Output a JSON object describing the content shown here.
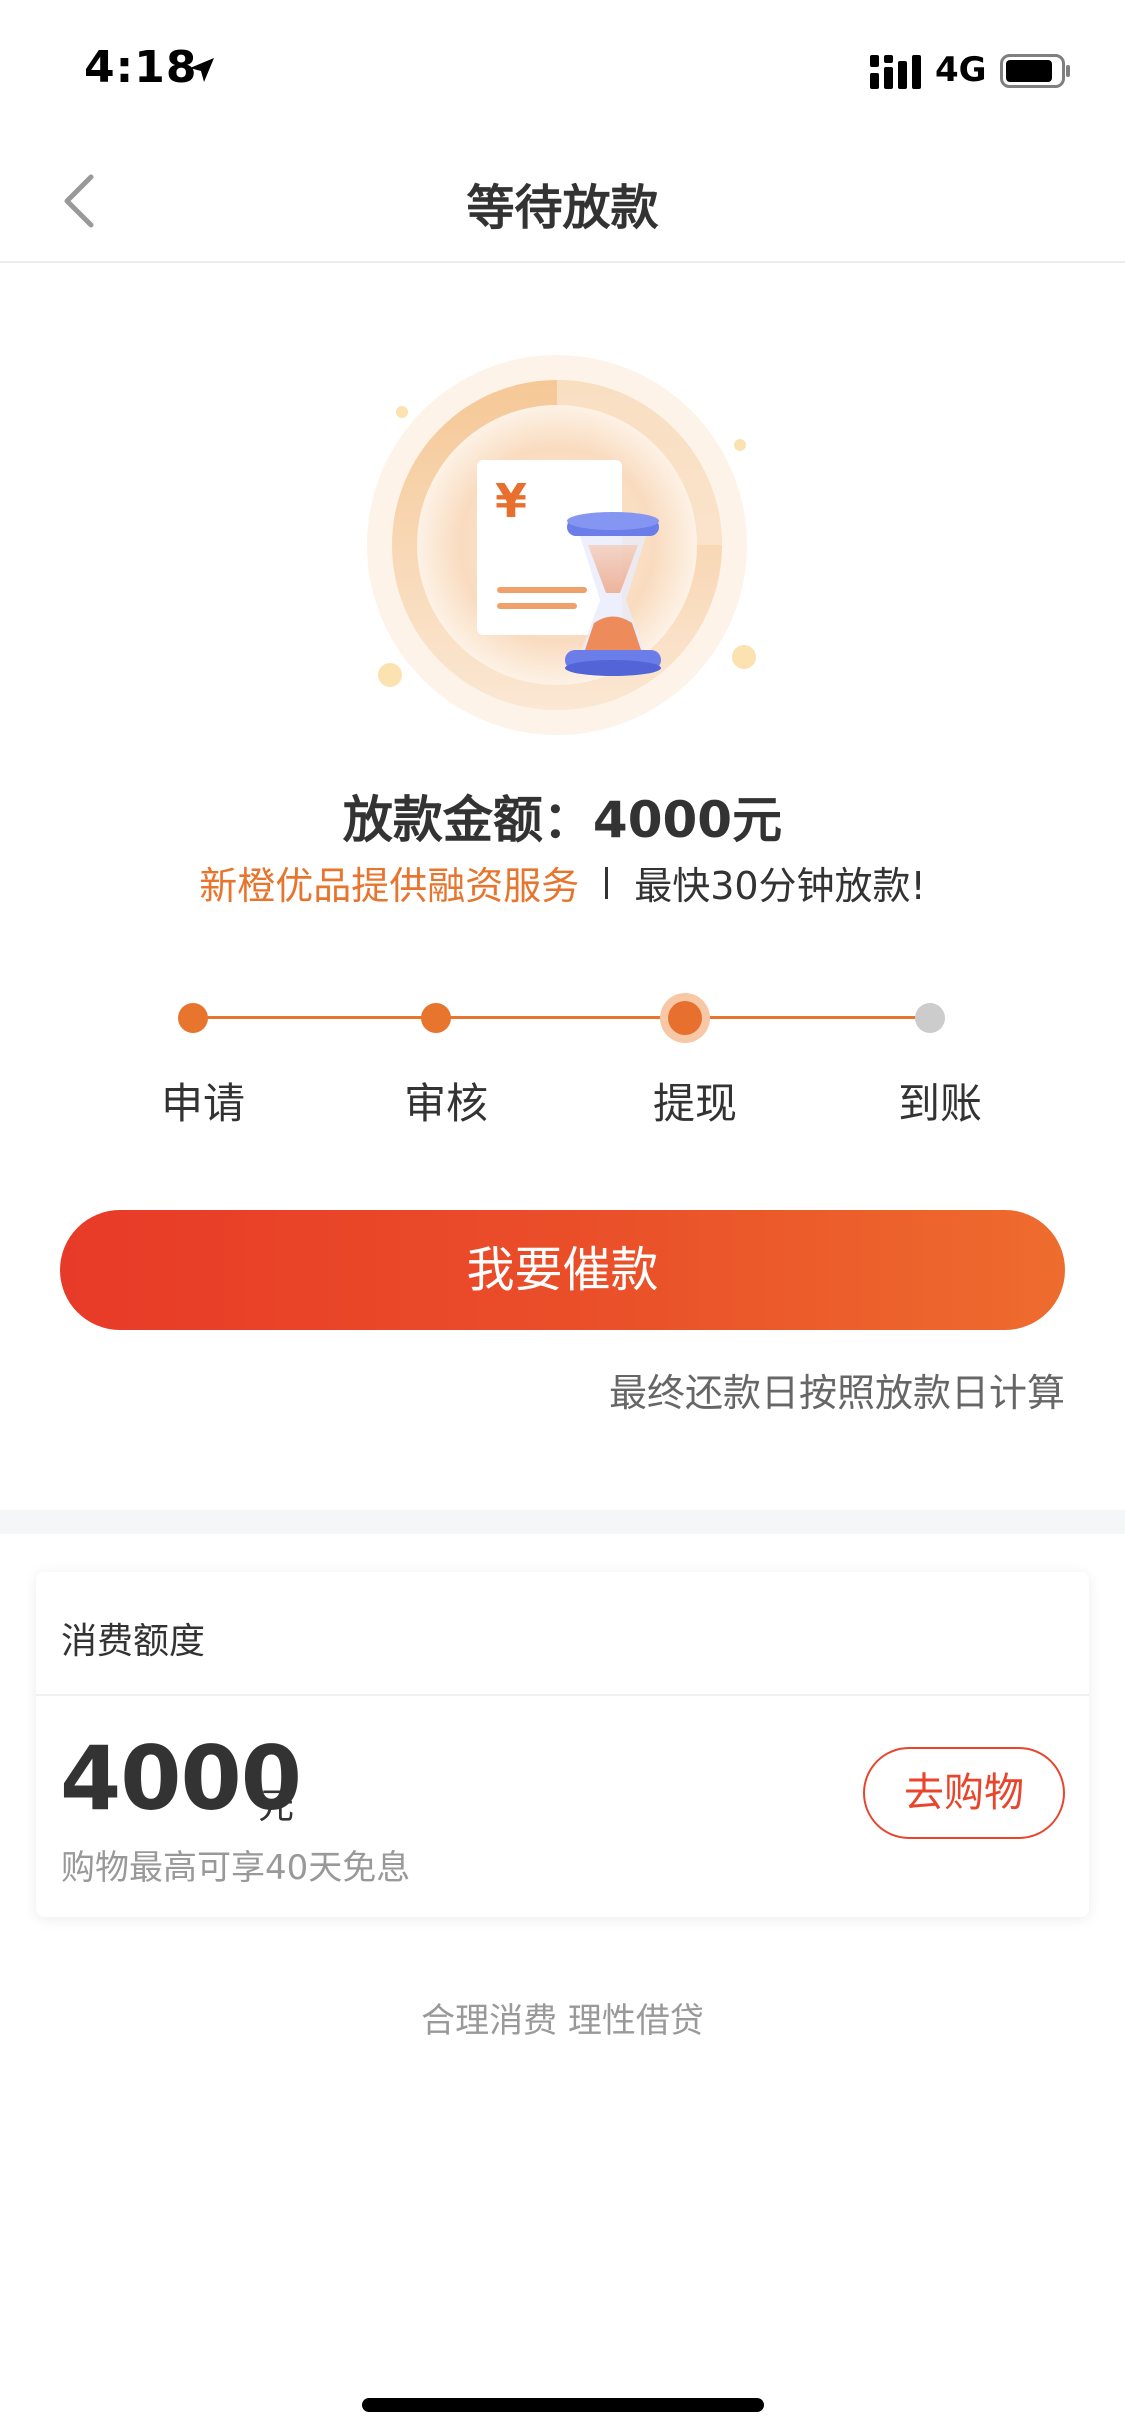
{
  "status_bar": {
    "time": "4:18",
    "network": "4G",
    "icons": [
      "location-arrow-icon",
      "signal-icon",
      "battery-icon"
    ]
  },
  "nav": {
    "title": "等待放款",
    "back_icon": "chevron-left-icon"
  },
  "loan": {
    "amount_label": "放款金额：",
    "amount_value": "4000元",
    "provider_text": "新橙优品提供融资服务",
    "speed_text": "最快30分钟放款!"
  },
  "steps": {
    "items": [
      {
        "label": "申请",
        "state": "done"
      },
      {
        "label": "审核",
        "state": "done"
      },
      {
        "label": "提现",
        "state": "current"
      },
      {
        "label": "到账",
        "state": "pending"
      }
    ],
    "current_index": 2
  },
  "actions": {
    "urge_label": "我要催款",
    "repay_note": "最终还款日按照放款日计算"
  },
  "credit": {
    "title": "消费额度",
    "amount": "4000",
    "unit": "元",
    "description": "购物最高可享40天免息",
    "shop_label": "去购物"
  },
  "footer": {
    "slogan": "合理消费 理性借贷"
  },
  "colors": {
    "accent_orange": "#e8752e",
    "button_start": "#e83a28",
    "button_end": "#ee6c2e",
    "shop_red": "#e8452c",
    "pending_gray": "#cccccc"
  }
}
